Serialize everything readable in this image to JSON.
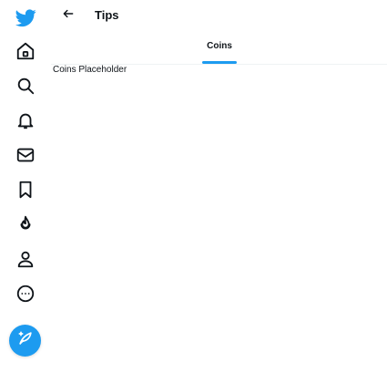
{
  "colors": {
    "accent": "#1d9bf0",
    "text": "#0f1419",
    "divider": "#eff3f4"
  },
  "sidebar": {
    "logo": "twitter-bird-icon",
    "items": [
      {
        "icon": "home-icon"
      },
      {
        "icon": "search-icon"
      },
      {
        "icon": "bell-icon"
      },
      {
        "icon": "mail-icon"
      },
      {
        "icon": "bookmark-icon"
      },
      {
        "icon": "flame-icon"
      },
      {
        "icon": "profile-icon"
      },
      {
        "icon": "more-icon"
      }
    ],
    "compose_icon": "compose-icon"
  },
  "header": {
    "back_icon": "arrow-left-icon",
    "title": "Tips"
  },
  "tabs": [
    {
      "label": "Coins",
      "active": true
    }
  ],
  "main": {
    "content": "Coins Placeholder"
  }
}
